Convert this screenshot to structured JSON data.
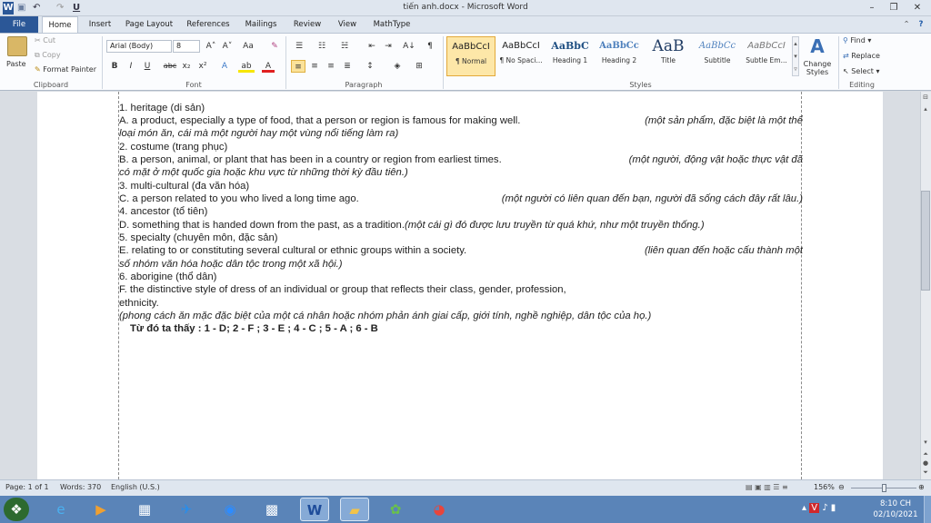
{
  "window": {
    "title": "tiến anh.docx - Microsoft Word",
    "app_icon": "W",
    "qat_undo": "↶",
    "qat_redo": "↷",
    "qat_underline": "U",
    "minimize": "–",
    "restore": "❐",
    "close": "✕",
    "help": "?"
  },
  "tabs": [
    "File",
    "Home",
    "Insert",
    "Page Layout",
    "References",
    "Mailings",
    "Review",
    "View",
    "MathType"
  ],
  "ribbon": {
    "clipboard": {
      "paste": "Paste",
      "cut": "Cut",
      "copy": "Copy",
      "format_painter": "Format Painter",
      "label": "Clipboard"
    },
    "font": {
      "name": "Arial (Body)",
      "size": "8",
      "label": "Font",
      "grow": "A˄",
      "shrink": "A˅",
      "case": "Aa",
      "clear": "✎",
      "bold": "B",
      "italic": "I",
      "underline": "U",
      "strike": "abc",
      "sub": "x₂",
      "sup": "x²",
      "effects": "A",
      "highlight": "ab",
      "color": "A"
    },
    "paragraph": {
      "label": "Paragraph",
      "pilcrow": "¶",
      "sort": "A↓"
    },
    "styles": {
      "label": "Styles",
      "items": [
        {
          "sample": "AaBbCcI",
          "name": "¶ Normal"
        },
        {
          "sample": "AaBbCcI",
          "name": "¶ No Spaci..."
        },
        {
          "sample": "AaBbC",
          "name": "Heading 1"
        },
        {
          "sample": "AaBbCc",
          "name": "Heading 2"
        },
        {
          "sample": "AaB",
          "name": "Title"
        },
        {
          "sample": "AaBbCc",
          "name": "Subtitle"
        },
        {
          "sample": "AaBbCcI",
          "name": "Subtle Em..."
        }
      ],
      "change_styles": "Change Styles"
    },
    "editing": {
      "find": "Find",
      "replace": "Replace",
      "select": "Select",
      "label": "Editing"
    }
  },
  "document": {
    "lines": [
      {
        "en": "1. heritage (di sản)",
        "vi": ""
      },
      {
        "en": "A. a product, especially a type of food, that a person or region is famous for making well.",
        "vi": "(một sản phẩm, đặc biệt là một thể"
      },
      {
        "en": "",
        "vi": "loại món ăn, cái mà một người hay một vùng nổi tiếng làm ra)"
      },
      {
        "en": "2. costume (trang phục)",
        "vi": ""
      },
      {
        "en": "B. a person, animal, or plant that has been in a country or region from earliest times.",
        "vi": "(một người, động vật hoặc thực vật đã"
      },
      {
        "en": "",
        "vi": "có mặt ở một quốc gia hoặc khu vực từ những thời kỳ đầu tiên.)"
      },
      {
        "en": "3. multi-cultural  (đa văn hóa)",
        "vi": ""
      },
      {
        "en": "C. a person related to you who lived a long time ago.",
        "vi": "(một người có liên quan đến bạn, người đã sống cách đây rất lâu.)"
      },
      {
        "en": "4. ancestor (tổ tiên)",
        "vi": ""
      },
      {
        "en": "D. something that is handed down from the past, as a tradition.",
        "vi": "(một cái gì đó được lưu truyền từ quá khứ, như một truyền thống.)"
      },
      {
        "en": "5. specialty (chuyên môn, đặc sản)",
        "vi": ""
      },
      {
        "en": "E. relating to or constituting several cultural or ethnic groups within a society.",
        "vi": "(liên quan đến hoặc cấu thành một"
      },
      {
        "en": "",
        "vi": "số nhóm văn hóa hoặc dân tộc trong một xã hội.)"
      },
      {
        "en": "6. aborigine  (thổ dân)",
        "vi": ""
      },
      {
        "en": "F.  the  distinctive  style  of  dress  of  an  individual  or  group  that  reflects  their  class,  gender,  profession,",
        "vi": ""
      },
      {
        "en": "ethnicity.",
        "vi": ""
      },
      {
        "en": "",
        "vi": "(phong cách ăn mặc đặc biệt của một cá nhân hoặc nhóm phản ánh giai cấp, giới tính, nghề nghiệp, dân tộc của họ.)"
      }
    ],
    "answer": "Từ đó ta thấy : 1 - D; 2 - F ; 3 - E ; 4 - C ; 5 - A ; 6 - B"
  },
  "status": {
    "page": "Page: 1 of 1",
    "words": "Words: 370",
    "language": "English (U.S.)",
    "zoom": "156%",
    "zoom_level": 0.52
  },
  "taskbar": {
    "time": "8:10 CH",
    "date": "02/10/2021"
  }
}
